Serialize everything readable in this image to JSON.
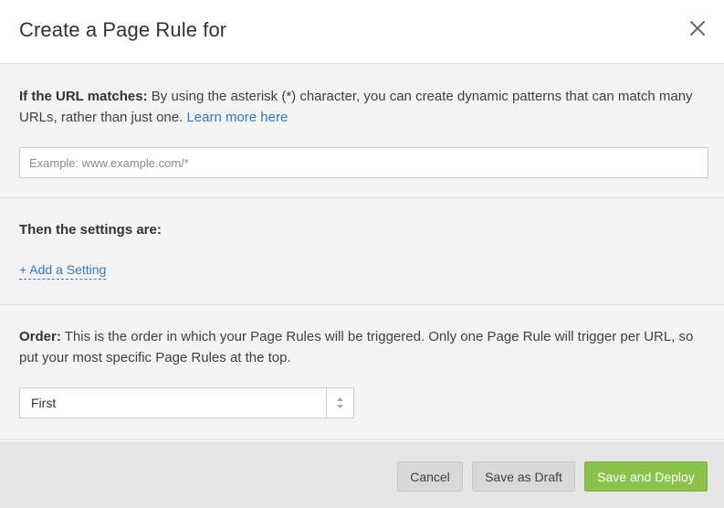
{
  "header": {
    "title": "Create a Page Rule for",
    "close_icon": "close-icon"
  },
  "url_section": {
    "label": "If the URL matches:",
    "description": "By using the asterisk (*) character, you can create dynamic patterns that can match many URLs, rather than just one.",
    "learn_more_link": "Learn more here",
    "input_placeholder": "Example: www.example.com/*",
    "input_value": ""
  },
  "settings_section": {
    "heading": "Then the settings are:",
    "add_setting_link": "+ Add a Setting"
  },
  "order_section": {
    "label": "Order:",
    "description": "This is the order in which your Page Rules will be triggered. Only one Page Rule will trigger per URL, so put your most specific Page Rules at the top.",
    "select_value": "First",
    "select_icon": "up-down-arrows-icon"
  },
  "footer": {
    "cancel_label": "Cancel",
    "save_draft_label": "Save as Draft",
    "save_deploy_label": "Save and Deploy"
  },
  "colors": {
    "link": "#2f7bbf",
    "primary_button": "#8bc34a",
    "section_background": "#f3f3f3",
    "footer_background": "#e6e6e6"
  }
}
